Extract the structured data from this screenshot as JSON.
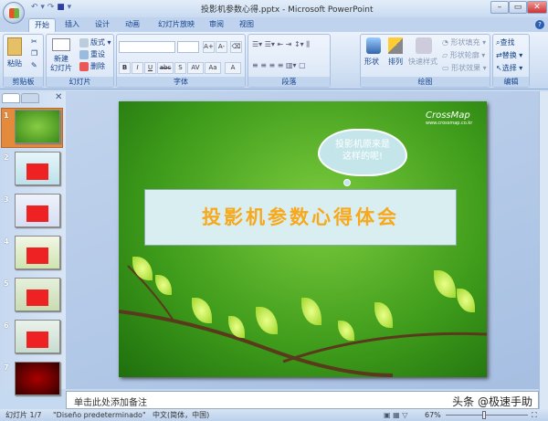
{
  "window": {
    "title": "投影机参数心得.pptx - Microsoft PowerPoint",
    "minimize": "–",
    "restore": "▭",
    "close": "✕"
  },
  "tabs": [
    {
      "label": "开始",
      "active": true
    },
    {
      "label": "插入"
    },
    {
      "label": "设计"
    },
    {
      "label": "动画"
    },
    {
      "label": "幻灯片放映"
    },
    {
      "label": "审阅"
    },
    {
      "label": "视图"
    }
  ],
  "ribbon": {
    "clipboard": {
      "label": "剪贴板",
      "paste": "粘贴"
    },
    "slides": {
      "label": "幻灯片",
      "new_slide": "新建\n幻灯片",
      "layout": "版式",
      "reset": "重设",
      "delete": "删除"
    },
    "font": {
      "label": "字体",
      "bold": "B",
      "italic": "I",
      "underline": "U",
      "strike": "abc",
      "shadow": "S",
      "spacing": "AV",
      "case": "Aa",
      "color": "A",
      "grow": "A+",
      "shrink": "A-"
    },
    "paragraph": {
      "label": "段落"
    },
    "drawing": {
      "label": "绘图",
      "shapes": "形状",
      "arrange": "排列",
      "quick_styles": "快速样式",
      "fill": "形状填充",
      "outline": "形状轮廓",
      "effects": "形状效果"
    },
    "editing": {
      "label": "编辑",
      "find": "查找",
      "replace": "替换",
      "select": "选择"
    }
  },
  "slides_pane": {
    "thumbnails": [
      {
        "num": "1",
        "selected": true
      },
      {
        "num": "2"
      },
      {
        "num": "3"
      },
      {
        "num": "4"
      },
      {
        "num": "5"
      },
      {
        "num": "6"
      },
      {
        "num": "7"
      }
    ]
  },
  "slide": {
    "title": "投影机参数心得体会",
    "cloud_text": "投影机原来是\n这样的呢!",
    "logo": "CrossMap",
    "logo_url": "www.crossmap.co.kr"
  },
  "notes": {
    "placeholder": "单击此处添加备注",
    "watermark": "头条 @极速手助"
  },
  "status": {
    "slide": "幻灯片 1/7",
    "theme": "\"Diseño predeterminado\"",
    "language": "中文(简体，中国)",
    "zoom": "67%"
  }
}
